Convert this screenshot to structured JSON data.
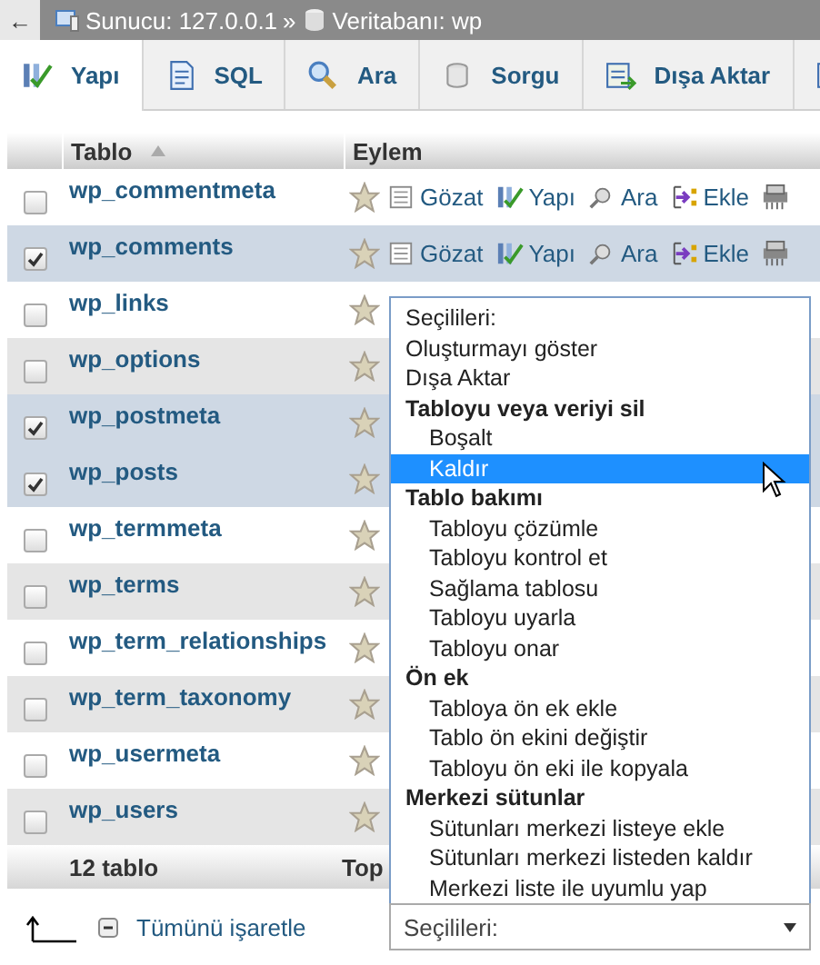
{
  "breadcrumb": {
    "back": "←",
    "server": "Sunucu: 127.0.0.1",
    "separator": "»",
    "database": "Veritabanı: wp"
  },
  "tabs": [
    {
      "kind": "structure",
      "label": "Yapı",
      "selected": true
    },
    {
      "kind": "sql",
      "label": "SQL",
      "selected": false
    },
    {
      "kind": "search",
      "label": "Ara",
      "selected": false
    },
    {
      "kind": "query",
      "label": "Sorgu",
      "selected": false
    },
    {
      "kind": "export",
      "label": "Dışa Aktar",
      "selected": false
    },
    {
      "kind": "import",
      "selected": false
    }
  ],
  "table": {
    "columns": [
      "Tablo",
      "Eylem"
    ],
    "rows": [
      {
        "name": "wp_commentmeta",
        "checked": false,
        "actions": [
          {
            "kind": "browse",
            "label": "Gözat"
          },
          {
            "kind": "structure",
            "label": "Yapı"
          },
          {
            "kind": "search",
            "label": "Ara"
          },
          {
            "kind": "insert",
            "label": "Ekle"
          },
          {
            "kind": "empty"
          }
        ]
      },
      {
        "name": "wp_comments",
        "checked": true,
        "actions": [
          {
            "kind": "browse",
            "label": "Gözat"
          },
          {
            "kind": "structure",
            "label": "Yapı"
          },
          {
            "kind": "search",
            "label": "Ara"
          },
          {
            "kind": "insert",
            "label": "Ekle"
          },
          {
            "kind": "empty"
          }
        ]
      },
      {
        "name": "wp_links",
        "checked": false
      },
      {
        "name": "wp_options",
        "checked": false
      },
      {
        "name": "wp_postmeta",
        "checked": true
      },
      {
        "name": "wp_posts",
        "checked": true
      },
      {
        "name": "wp_termmeta",
        "checked": false
      },
      {
        "name": "wp_terms",
        "checked": false
      },
      {
        "name": "wp_term_relationships",
        "checked": false
      },
      {
        "name": "wp_term_taxonomy",
        "checked": false
      },
      {
        "name": "wp_usermeta",
        "checked": false
      },
      {
        "name": "wp_users",
        "checked": false
      }
    ],
    "footer": {
      "count": "12 tablo",
      "column_2": "Top"
    }
  },
  "bulk": {
    "check_all": "Tümünü işaretle",
    "select_value": "Seçilileri:"
  },
  "dropdown": {
    "options": [
      {
        "label": "Seçilileri:",
        "selected": false
      },
      {
        "label": "Oluşturmayı göster",
        "selected": false
      },
      {
        "label": "Dışa Aktar",
        "selected": false
      }
    ],
    "groups": [
      {
        "label": "Tabloyu veya veriyi sil",
        "options": [
          {
            "label": "Boşalt",
            "selected": false
          },
          {
            "label": "Kaldır",
            "selected": true
          }
        ]
      },
      {
        "label": "Tablo bakımı",
        "options": [
          {
            "label": "Tabloyu çözümle",
            "selected": false
          },
          {
            "label": "Tabloyu kontrol et",
            "selected": false
          },
          {
            "label": "Sağlama tablosu",
            "selected": false
          },
          {
            "label": "Tabloyu uyarla",
            "selected": false
          },
          {
            "label": "Tabloyu onar",
            "selected": false
          }
        ]
      },
      {
        "label": "Ön ek",
        "options": [
          {
            "label": "Tabloya ön ek ekle",
            "selected": false
          },
          {
            "label": "Tablo ön ekini değiştir",
            "selected": false
          },
          {
            "label": "Tabloyu ön eki ile kopyala",
            "selected": false
          }
        ]
      },
      {
        "label": "Merkezi sütunlar",
        "options": [
          {
            "label": "Sütunları merkezi listeye ekle",
            "selected": false
          },
          {
            "label": "Sütunları merkezi listeden kaldır",
            "selected": false
          },
          {
            "label": "Merkezi liste ile uyumlu yap",
            "selected": false
          }
        ]
      }
    ]
  }
}
